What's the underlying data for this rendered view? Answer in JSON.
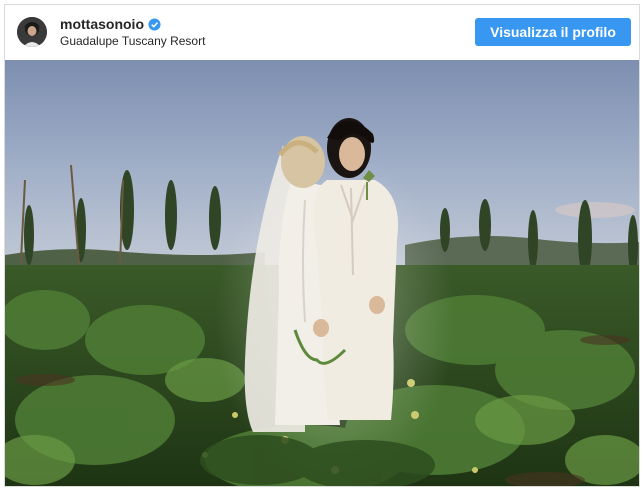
{
  "post": {
    "username": "mottasonoio",
    "verified": true,
    "location": "Guadalupe Tuscany Resort",
    "view_profile_label": "Visualizza il profilo"
  },
  "icons": {
    "verified": "verified-badge-icon",
    "avatar": "avatar"
  },
  "colors": {
    "accent": "#3897f0",
    "border": "#dbdbdb",
    "text": "#262626"
  }
}
